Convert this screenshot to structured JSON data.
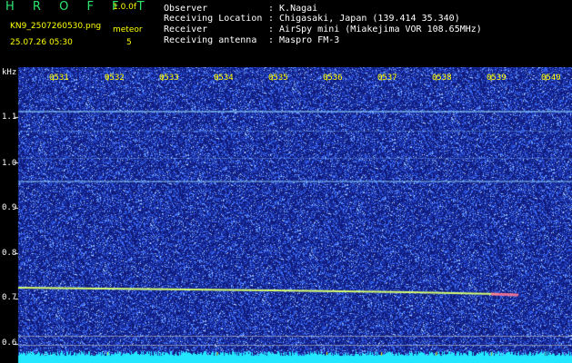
{
  "header": {
    "app_title": "H R O F F T",
    "version": "1.0.0f",
    "filename": "KN9_2507260530.png",
    "meteor_label": "meteor",
    "datetime": "25.07.26 05:30",
    "meteor_count": "5"
  },
  "info": {
    "rows": [
      {
        "label": "Observer",
        "value": ": K.Nagai"
      },
      {
        "label": "Receiving Location",
        "value": ": Chigasaki, Japan (139.414 35.340)"
      },
      {
        "label": "Receiver",
        "value": ": AirSpy mini (Miakejima VOR 108.65MHz)"
      },
      {
        "label": "Receiving antenna",
        "value": ": Maspro FM-3"
      }
    ]
  },
  "spectrogram": {
    "y_unit": "kHz",
    "y_ticks": [
      "1.1",
      "1.0",
      "0.9",
      "0.8",
      "0.7",
      "0.6"
    ],
    "x_ticks": [
      "0531",
      "0532",
      "0533",
      "0534",
      "0535",
      "0536",
      "0537",
      "0538",
      "0539",
      "0540"
    ],
    "background_color": "#101a7a",
    "noise_color": "#3a6cff",
    "trace_color": "#d8ff70",
    "baseline_color": "#23e6ff"
  }
}
